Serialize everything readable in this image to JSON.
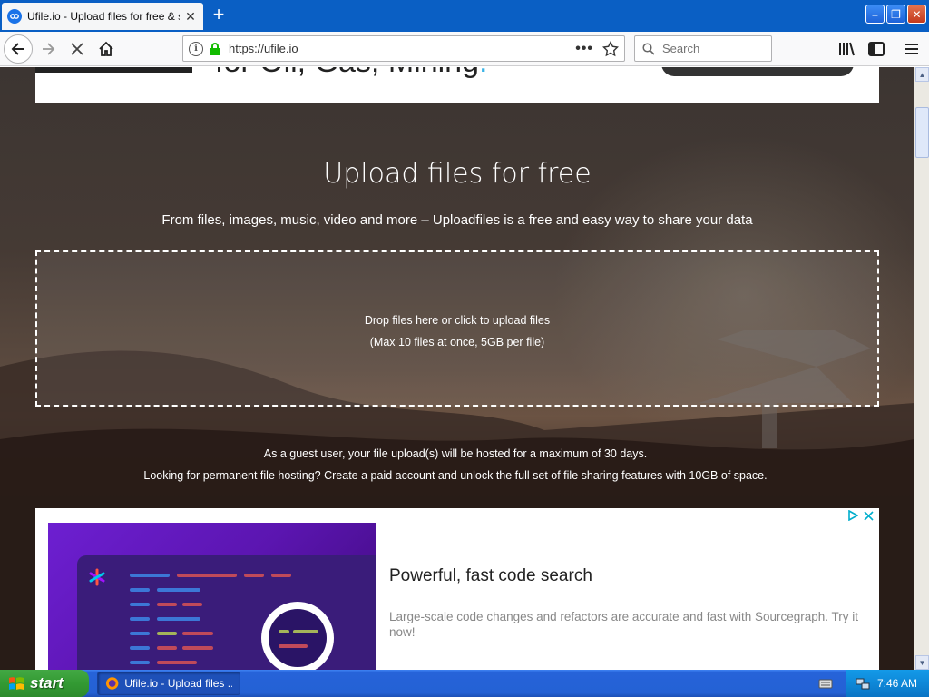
{
  "browser": {
    "tab_title": "Ufile.io - Upload files for free & sh",
    "url": "https://ufile.io",
    "search_placeholder": "Search"
  },
  "top_ad": {
    "text": "for Oil, Gas, Mining",
    "dot": "."
  },
  "hero": {
    "title": "Upload files for free",
    "subtitle": "From files, images, music, video and more – Uploadfiles is a free and easy way to share your data"
  },
  "dropzone": {
    "line1": "Drop files here or click to upload files",
    "line2": "(Max 10 files at once, 5GB per file)"
  },
  "guest": {
    "line1": "As a guest user, your file upload(s) will be hosted for a maximum of 30 days.",
    "line2": "Looking for permanent file hosting? Create a paid account and unlock the full set of file sharing features with 10GB of space."
  },
  "ad": {
    "title": "Powerful, fast code search",
    "description": "Large-scale code changes and refactors are accurate and fast with Sourcegraph. Try it now!"
  },
  "taskbar": {
    "start_label": "start",
    "task_label": "Ufile.io - Upload files ...",
    "clock": "7:46 AM"
  },
  "colors": {
    "accent_blue": "#0a5fc4",
    "ad_purple": "#6d1fd1",
    "start_green": "#339a33"
  }
}
